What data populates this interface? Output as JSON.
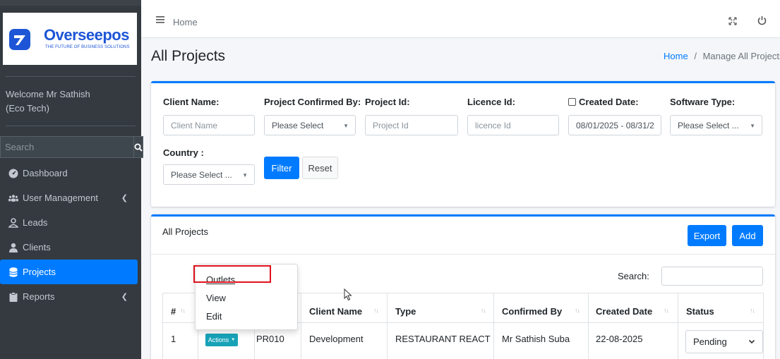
{
  "brand": {
    "name": "Overseepos",
    "tagline": "THE FUTURE OF BUSINESS SOLUTIONS",
    "color": "#1d55d6"
  },
  "sidebar": {
    "welcome_line1": "Welcome Mr Sathish",
    "welcome_line2": "(Eco Tech)",
    "search_placeholder": "Search",
    "items": [
      {
        "label": "Dashboard",
        "icon": "dashboard-icon",
        "has_submenu": false
      },
      {
        "label": "User Management",
        "icon": "users-icon",
        "has_submenu": true
      },
      {
        "label": "Leads",
        "icon": "leads-icon",
        "has_submenu": false
      },
      {
        "label": "Clients",
        "icon": "user-icon",
        "has_submenu": false
      },
      {
        "label": "Projects",
        "icon": "database-icon",
        "has_submenu": false,
        "active": true
      },
      {
        "label": "Reports",
        "icon": "clipboard-icon",
        "has_submenu": true
      }
    ]
  },
  "topbar": {
    "home_label": "Home"
  },
  "page": {
    "title": "All Projects",
    "breadcrumb_home": "Home",
    "breadcrumb_sep": "/",
    "breadcrumb_current": "Manage All Projects"
  },
  "filters": {
    "client_name_label": "Client Name:",
    "client_name_placeholder": "Client Name",
    "confirmed_by_label": "Project Confirmed By:",
    "confirmed_by_value": "Please Select",
    "project_id_label": "Project Id:",
    "project_id_placeholder": "Project Id",
    "licence_id_label": "Licence Id:",
    "licence_id_placeholder": "licence Id",
    "created_date_label": "Created Date:",
    "created_date_value": "08/01/2025 - 08/31/2",
    "software_type_label": "Software Type:",
    "software_type_value": "Please Select ...",
    "country_label": "Country :",
    "country_value": "Please Select ...",
    "filter_button": "Filter",
    "reset_button": "Reset"
  },
  "table_card": {
    "title": "All Projects",
    "export_button": "Export",
    "add_button": "Add",
    "search_label": "Search:",
    "columns": [
      "#",
      "",
      "",
      "Client Name",
      "Type",
      "Confirmed By",
      "Created Date",
      "Status"
    ],
    "rows": [
      {
        "index": "1",
        "actions": "Actions",
        "project_id": "PR010",
        "client_name": "Development",
        "type": "RESTAURANT REACT",
        "confirmed_by": "Mr Sathish Suba",
        "created_date": "22-08-2025",
        "status": "Pending"
      }
    ]
  },
  "dropdown": {
    "items": [
      "Outlets",
      "View",
      "Edit"
    ]
  },
  "colors": {
    "primary": "#007bff",
    "sidebar": "#343a40",
    "info": "#17a2b8",
    "highlight": "#e0111c"
  }
}
